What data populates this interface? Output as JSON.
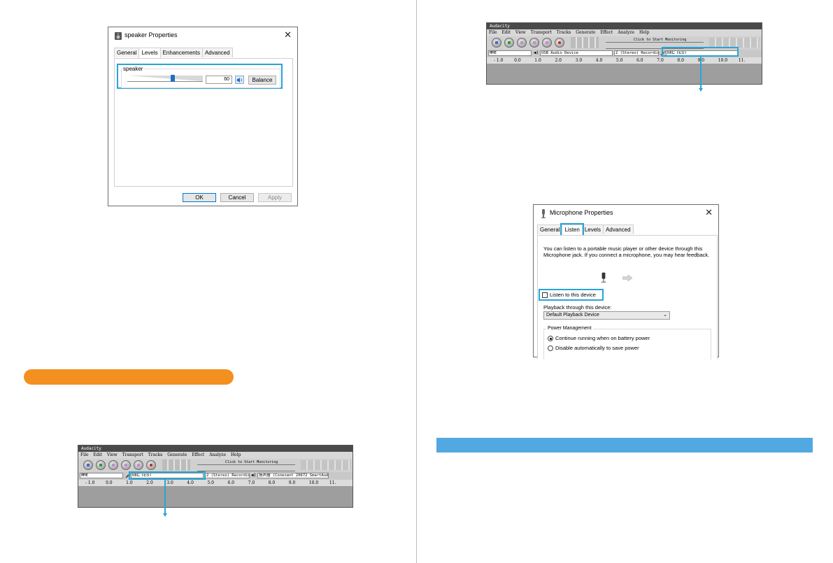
{
  "speaker_dialog": {
    "title": "speaker Properties",
    "close": "✕",
    "tabs": [
      "General",
      "Levels",
      "Enhancements",
      "Advanced"
    ],
    "active_tab": "Levels",
    "group_label": "speaker",
    "level_value": "60",
    "level_fraction": 0.6,
    "balance_button": "Balance",
    "ok_button": "OK",
    "cancel_button": "Cancel",
    "apply_button": "Apply"
  },
  "audacity_top": {
    "title": "Audacity",
    "menu": [
      "File",
      "Edit",
      "View",
      "Transport",
      "Tracks",
      "Generate",
      "Effect",
      "Analyze",
      "Help"
    ],
    "monitor_hint": "Click to Start Monitoring",
    "host": "MME",
    "playback_device": "USB Audio Device",
    "channels": "2 (Stereo) Recordin",
    "recording_device": "MIC TEST",
    "ruler": [
      "- 1.0",
      "0.0",
      "1.0",
      "2.0",
      "3.0",
      "4.0",
      "5.0",
      "6.0",
      "7.0",
      "8.0",
      "9.0",
      "10.0",
      "11."
    ]
  },
  "microphone_dialog": {
    "title": "Microphone Properties",
    "close": "✕",
    "tabs": [
      "General",
      "Listen",
      "Levels",
      "Advanced"
    ],
    "active_tab": "Listen",
    "description": "You can listen to a portable music player or other device through this Microphone jack.  If you connect a microphone, you may hear feedback.",
    "listen_checkbox": "Listen to this device",
    "listen_checked": false,
    "playback_label": "Playback through this device:",
    "playback_value": "Default Playback Device",
    "power_label": "Power Management",
    "power_option_1": "Continue running when on battery power",
    "power_option_2": "Disable automatically to save power"
  },
  "audacity_bottom": {
    "title": "Audacity",
    "menu": [
      "File",
      "Edit",
      "View",
      "Transport",
      "Tracks",
      "Generate",
      "Effect",
      "Analyze",
      "Help"
    ],
    "monitor_hint": "Click to Start Monitoring",
    "host": "MME",
    "recording_device": "MIC TEST",
    "channels": "2 (Stereo) Recordin",
    "playback_device": "扬声器 (Conexant 20672 SmartAud",
    "ruler": [
      "- 1.0",
      "0.0",
      "1.0",
      "2.0",
      "3.0",
      "4.0",
      "5.0",
      "6.0",
      "7.0",
      "8.0",
      "9.0",
      "10.0",
      "11."
    ]
  },
  "colors": {
    "highlight": "#27a5d6",
    "orange_bar": "#f39020",
    "blue_bar": "#52a9e1"
  }
}
